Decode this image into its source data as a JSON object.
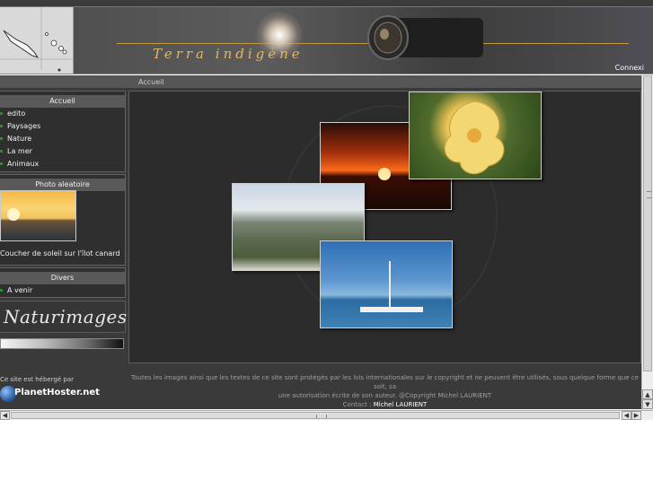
{
  "banner": {
    "site_title": "Terra indigène",
    "connexion_label": "Connexi"
  },
  "breadcrumb": {
    "current": "Accueil"
  },
  "sidebar": {
    "accueil": {
      "title": "Accueil",
      "items": [
        {
          "label": "edito"
        },
        {
          "label": "Paysages"
        },
        {
          "label": "Nature"
        },
        {
          "label": "La mer"
        },
        {
          "label": "Animaux"
        }
      ]
    },
    "photo": {
      "title": "Photo aleatoire",
      "caption": "Coucher de soleil sur l'îlot canard"
    },
    "divers": {
      "title": "Divers",
      "items": [
        {
          "label": "A venir"
        }
      ]
    },
    "naturimages_logo": "Naturimages"
  },
  "footer": {
    "hosted_text": "Ce site est hébergé par",
    "host_logo": "PlanetHoster.net",
    "copyright_line1": "Toutes les images ainsi que les textes de ce site sont protégés par les lois internationales sur le copyright et ne peuvent être utilisés, sous quelque forme que ce soit, sa",
    "copyright_line2": "une autorisation écrite de son auteur. @Copyright Michel LAURIENT",
    "contact_label": "Contact :",
    "contact_name": "Michel LAURIENT"
  },
  "icons": {
    "menu_bullet": "bullet-icon",
    "planet": "globe-icon",
    "scroll_up": "▲",
    "scroll_down": "▼",
    "scroll_left": "◀",
    "scroll_right": "▶"
  },
  "colors": {
    "accent_gold": "#e7b75c",
    "bullet_green": "#2c8c2c"
  }
}
